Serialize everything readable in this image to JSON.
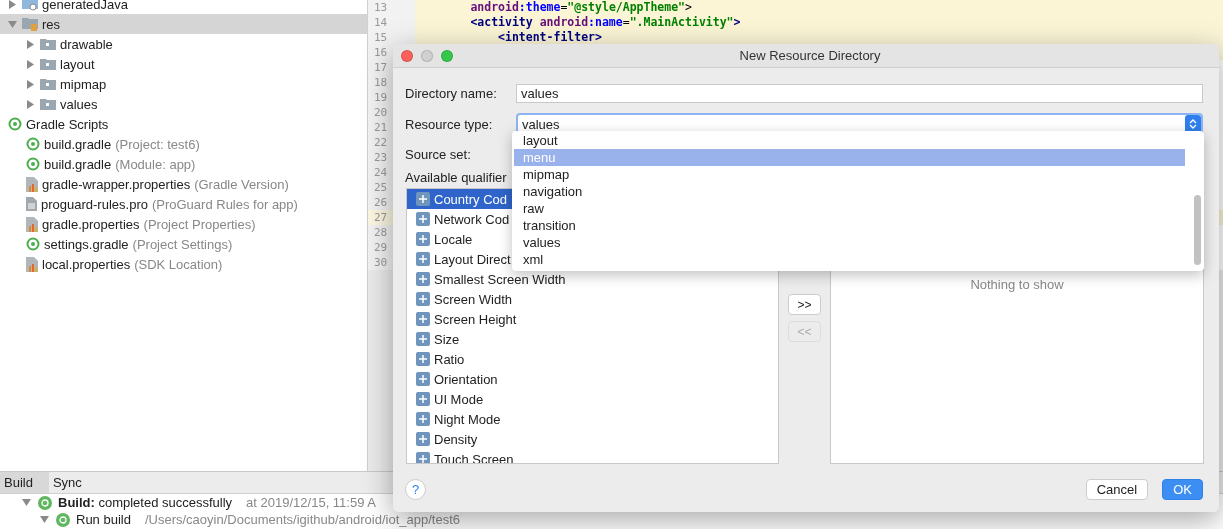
{
  "project_tree": {
    "items": [
      {
        "label": "generatedJava",
        "kind": "generated",
        "expanded": false,
        "selected": false
      },
      {
        "label": "res",
        "kind": "res",
        "expanded": true,
        "selected": true,
        "children": [
          {
            "label": "drawable",
            "expanded": false
          },
          {
            "label": "layout",
            "expanded": false
          },
          {
            "label": "mipmap",
            "expanded": false
          },
          {
            "label": "values",
            "expanded": false
          }
        ]
      }
    ],
    "gradle_scripts": {
      "label": "Gradle Scripts",
      "files": [
        {
          "label": "build.gradle",
          "note": "(Project: test6)",
          "kind": "gradle"
        },
        {
          "label": "build.gradle",
          "note": "(Module: app)",
          "kind": "gradle"
        },
        {
          "label": "gradle-wrapper.properties",
          "note": "(Gradle Version)",
          "kind": "properties"
        },
        {
          "label": "proguard-rules.pro",
          "note": "(ProGuard Rules for app)",
          "kind": "text"
        },
        {
          "label": "gradle.properties",
          "note": "(Project Properties)",
          "kind": "properties"
        },
        {
          "label": "settings.gradle",
          "note": "(Project Settings)",
          "kind": "gradle"
        },
        {
          "label": "local.properties",
          "note": "(SDK Location)",
          "kind": "properties"
        }
      ]
    }
  },
  "editor": {
    "lines": [
      {
        "number": "13",
        "highlighted": false,
        "tokens": [
          {
            "text": "        android",
            "kind": "ns"
          },
          {
            "text": ":theme",
            "kind": "attr"
          },
          {
            "text": "=",
            "kind": "plain"
          },
          {
            "text": "\"@style/AppTheme\"",
            "kind": "string"
          },
          {
            "text": ">",
            "kind": "plain"
          }
        ]
      },
      {
        "number": "14",
        "highlighted": false,
        "tokens": [
          {
            "text": "        <activity",
            "kind": "tag"
          },
          {
            "text": " android",
            "kind": "ns"
          },
          {
            "text": ":name",
            "kind": "attr"
          },
          {
            "text": "=",
            "kind": "plain"
          },
          {
            "text": "\".MainActivity\"",
            "kind": "string"
          },
          {
            "text": ">",
            "kind": "tag"
          }
        ]
      },
      {
        "number": "15",
        "highlighted": false,
        "tokens": [
          {
            "text": "            <intent-filter>",
            "kind": "tag"
          }
        ]
      },
      {
        "number": "16",
        "highlighted": false
      },
      {
        "number": "17",
        "highlighted": false
      },
      {
        "number": "18",
        "highlighted": false
      },
      {
        "number": "19",
        "highlighted": false
      },
      {
        "number": "20",
        "highlighted": false
      },
      {
        "number": "21",
        "highlighted": false
      },
      {
        "number": "22",
        "highlighted": false
      },
      {
        "number": "23",
        "highlighted": false
      },
      {
        "number": "24",
        "highlighted": false
      },
      {
        "number": "25",
        "highlighted": false
      },
      {
        "number": "26",
        "highlighted": false
      },
      {
        "number": "27",
        "highlighted": true
      },
      {
        "number": "28",
        "highlighted": false
      },
      {
        "number": "29",
        "highlighted": false
      },
      {
        "number": "30",
        "highlighted": false
      }
    ]
  },
  "build_panel": {
    "tabs": [
      {
        "label": "Build",
        "selected": true
      },
      {
        "label": "Sync",
        "selected": false
      }
    ],
    "rows": [
      {
        "text": "**Build:** completed successfully",
        "time": "at 2019/12/15, 11:59 A",
        "expanded": true,
        "children": [
          {
            "text": "Run build",
            "path": "/Users/caoyin/Documents/igithub/android/iot_app/test6",
            "expanded": true
          }
        ]
      }
    ]
  },
  "dialog": {
    "title": "New Resource Directory",
    "fields": [
      {
        "label": "Directory name:",
        "value": "values",
        "kind": "text"
      },
      {
        "label": "Resource type:",
        "value": "values",
        "kind": "select"
      },
      {
        "label": "Source set:",
        "kind": "covered"
      }
    ],
    "available_label": "Available qualifier",
    "qualifiers": [
      {
        "label": "Country Cod",
        "selected": true
      },
      {
        "label": "Network Cod",
        "selected": false
      },
      {
        "label": "Locale",
        "selected": false
      },
      {
        "label": "Layout Direct",
        "selected": false
      },
      {
        "label": "Smallest Screen Width",
        "selected": false
      },
      {
        "label": "Screen Width",
        "selected": false
      },
      {
        "label": "Screen Height",
        "selected": false
      },
      {
        "label": "Size",
        "selected": false
      },
      {
        "label": "Ratio",
        "selected": false
      },
      {
        "label": "Orientation",
        "selected": false
      },
      {
        "label": "UI Mode",
        "selected": false
      },
      {
        "label": "Night Mode",
        "selected": false
      },
      {
        "label": "Density",
        "selected": false
      },
      {
        "label": "Touch Screen",
        "selected": false
      }
    ],
    "add_button": {
      "label": ">>",
      "disabled": false
    },
    "remove_button": {
      "label": "<<",
      "disabled": true
    },
    "chosen_empty": "Nothing to show",
    "help_button": "?",
    "buttons": [
      {
        "label": "Cancel",
        "primary": false
      },
      {
        "label": "OK",
        "primary": true
      }
    ],
    "dropdown": {
      "options": [
        {
          "label": "layout",
          "selected": false
        },
        {
          "label": "menu",
          "selected": true
        },
        {
          "label": "mipmap",
          "selected": false
        },
        {
          "label": "navigation",
          "selected": false
        },
        {
          "label": "raw",
          "selected": false
        },
        {
          "label": "transition",
          "selected": false
        },
        {
          "label": "values",
          "selected": false
        },
        {
          "label": "xml",
          "selected": false
        }
      ]
    }
  }
}
